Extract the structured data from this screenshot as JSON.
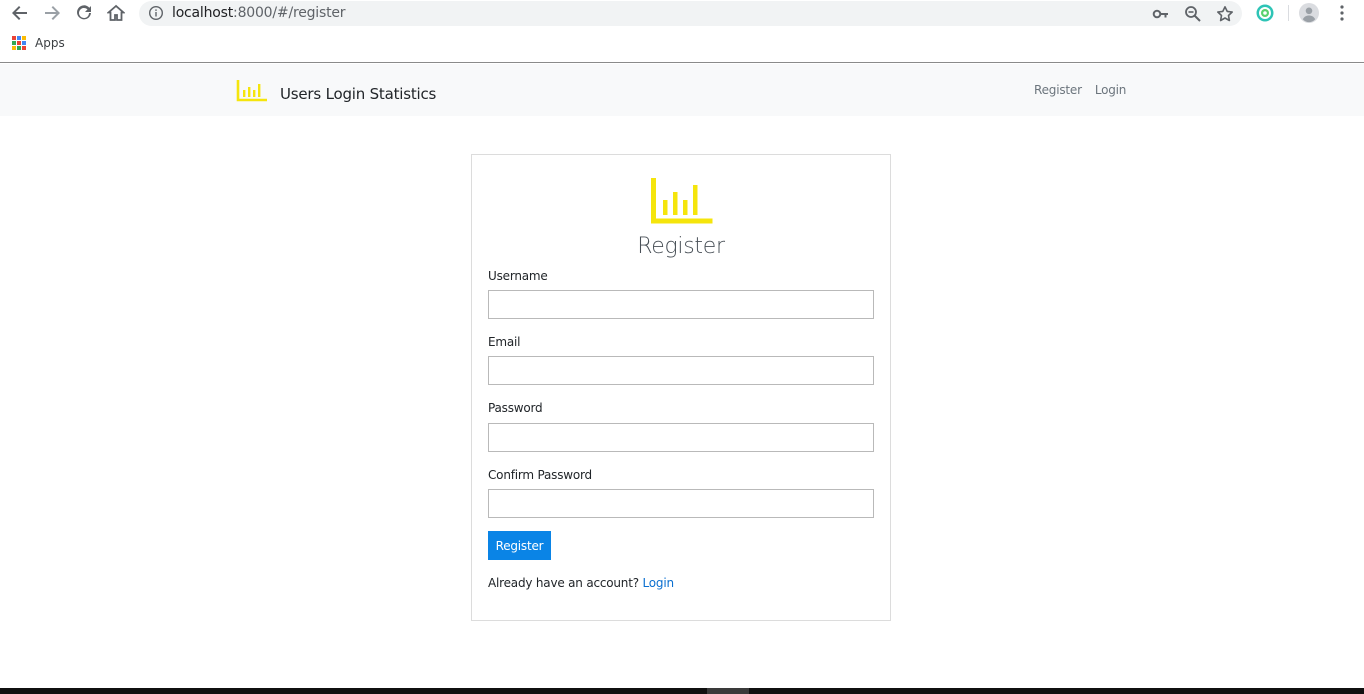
{
  "browser": {
    "url_host": "localhost",
    "url_rest": ":8000/#/register",
    "bookmarks": {
      "apps_label": "Apps"
    }
  },
  "navbar": {
    "brand_name": "Users Login Statistics",
    "links": [
      {
        "label": "Register"
      },
      {
        "label": "Login"
      }
    ]
  },
  "form": {
    "title": "Register",
    "fields": [
      {
        "label": "Username",
        "value": "",
        "placeholder": ""
      },
      {
        "label": "Email",
        "value": "",
        "placeholder": ""
      },
      {
        "label": "Password",
        "value": "",
        "placeholder": ""
      },
      {
        "label": "Confirm Password",
        "value": "",
        "placeholder": ""
      }
    ],
    "submit_label": "Register",
    "footer_text": "Already have an account?",
    "footer_link": "Login"
  },
  "colors": {
    "brand_yellow": "#f5e50c",
    "primary_button": "#0a84e6",
    "link": "#0a6fd0",
    "navbar_bg": "#f8f9fa"
  },
  "icons": {
    "back": "arrow-left-icon",
    "forward": "arrow-right-icon",
    "reload": "reload-icon",
    "home": "home-icon",
    "info": "info-icon",
    "key": "key-icon",
    "zoom": "zoom-out-icon",
    "star": "star-icon",
    "extension": "extension-icon",
    "profile": "profile-icon",
    "menu": "kebab-menu-icon",
    "brand": "bar-chart-icon"
  }
}
